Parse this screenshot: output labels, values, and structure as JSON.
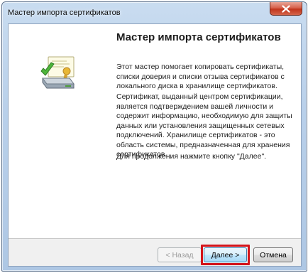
{
  "window": {
    "title": "Мастер импорта сертификатов"
  },
  "main": {
    "heading": "Мастер импорта сертификатов",
    "paragraph1": "Этот мастер помогает копировать сертификаты, списки доверия и списки отзыва сертификатов с локального диска в хранилище сертификатов.",
    "paragraph2": "Сертификат, выданный центром сертификации, является подтверждением вашей личности и содержит информацию, необходимую для защиты данных или установления защищенных сетевых подключений. Хранилище сертификатов - это область системы, предназначенная для хранения сертификатов.",
    "paragraph3": "Для продолжения нажмите кнопку \"Далее\"."
  },
  "footer": {
    "back_label": "< Назад",
    "next_label": "Далее >",
    "cancel_label": "Отмена"
  },
  "icons": {
    "close": "close-icon",
    "illustration": "certificate-import-icon"
  },
  "colors": {
    "highlight": "#d4141b",
    "close_button": "#c1351c"
  }
}
